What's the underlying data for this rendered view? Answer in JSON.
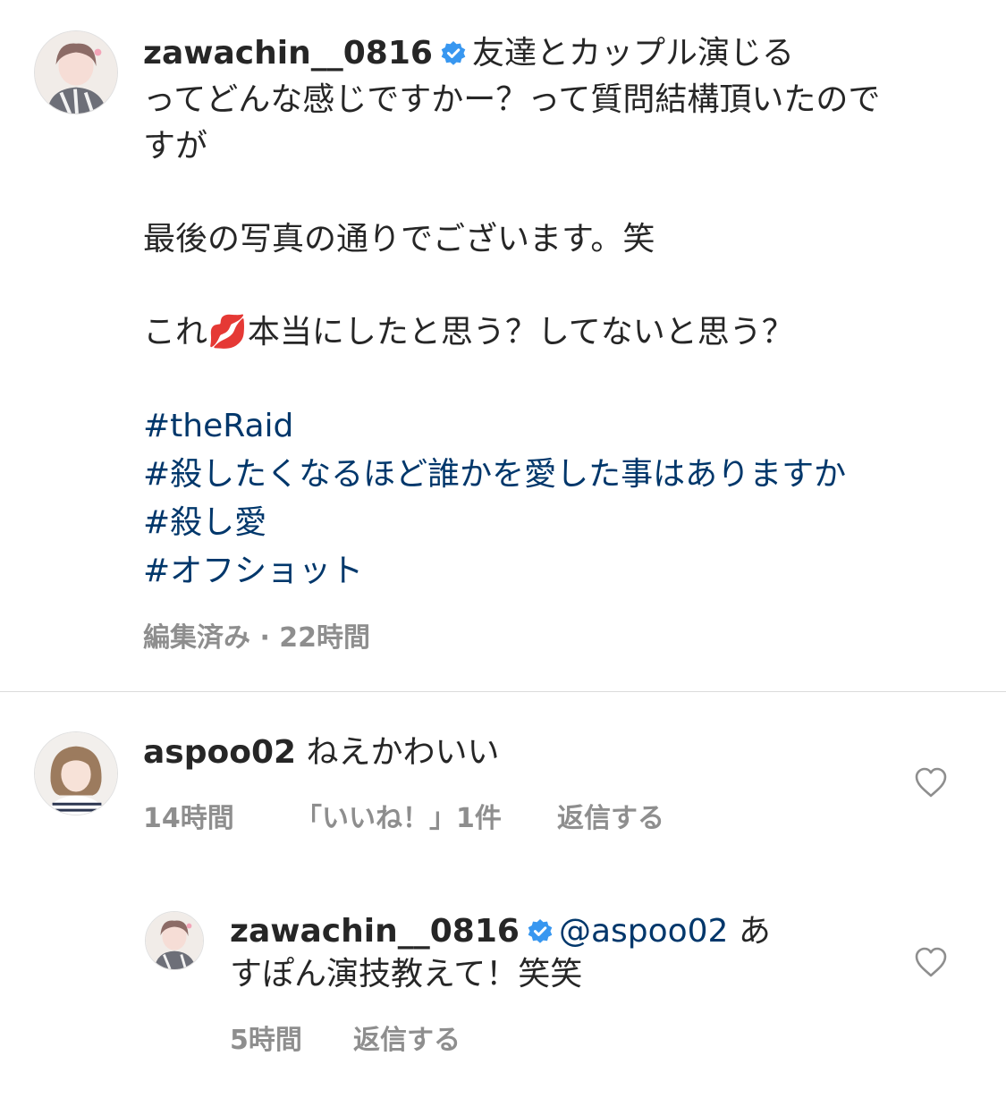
{
  "caption": {
    "username": "zawachin__0816",
    "line1": "友達とカップル演じる",
    "line2": "ってどんな感じですかー？って質問結構頂いたので",
    "line3": "すが",
    "para2": "最後の写真の通りでございます。笑",
    "para3_a": "これ",
    "para3_emoji": "💋",
    "para3_b": "本当にしたと思う？してないと思う？",
    "hashtags": [
      "#theRaid",
      "#殺したくなるほど誰かを愛した事はありますか",
      "#殺し愛",
      "#オフショット"
    ],
    "meta": "編集済み · 22時間"
  },
  "comments": [
    {
      "username": "aspoo02",
      "text": "ねえかわいい",
      "time": "14時間",
      "likes": "「いいね！」1件",
      "reply_label": "返信する"
    }
  ],
  "reply": {
    "username": "zawachin__0816",
    "mention": "@aspoo02",
    "text_a": "あ",
    "text_b": "すぽん演技教えて！笑笑",
    "time": "5時間",
    "reply_label": "返信する"
  },
  "colors": {
    "text": "#262626",
    "muted": "#8e8e8e",
    "link": "#00376b",
    "verified": "#3897f0",
    "divider": "#dbdbdb"
  },
  "icons": [
    "verified-badge-icon",
    "heart-icon",
    "lips-emoji"
  ]
}
